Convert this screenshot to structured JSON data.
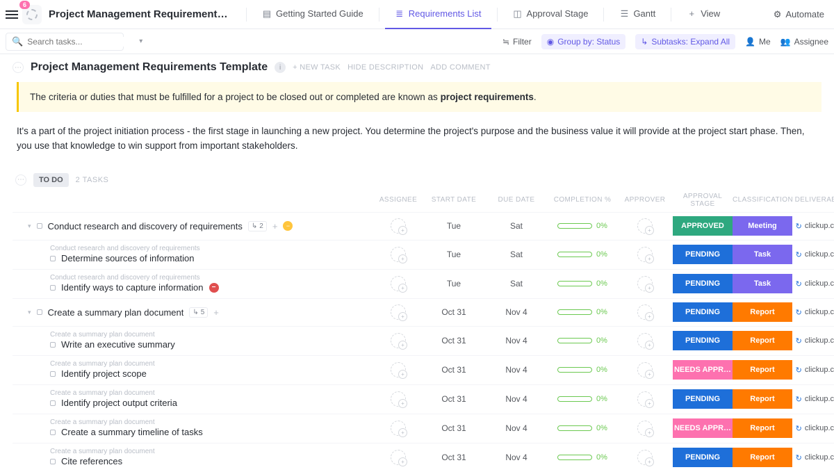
{
  "top": {
    "badge": "6",
    "title": "Project Management Requirements Te…",
    "views": {
      "guide": "Getting Started Guide",
      "reqlist": "Requirements List",
      "approval": "Approval Stage",
      "gantt": "Gantt",
      "view": "View"
    },
    "automate": "Automate"
  },
  "sub": {
    "search_ph": "Search tasks...",
    "filter": "Filter",
    "groupby": "Group by: Status",
    "subtasks": "Subtasks: Expand All",
    "me": "Me",
    "assignee": "Assignee"
  },
  "page": {
    "title": "Project Management Requirements Template",
    "newtask": "NEW TASK",
    "hidedesc": "HIDE DESCRIPTION",
    "addcomment": "ADD COMMENT",
    "banner_pre": "The criteria or duties that must be fulfilled for a project to be closed out or completed are known as ",
    "banner_bold": "project requirements",
    "banner_post": ".",
    "body": "It's a part of the project initiation process - the first stage in launching a new project. You determine the project's purpose and the business value it will provide at the project start phase. Then, you use that knowledge to win support from important stakeholders."
  },
  "group": {
    "status": "TO DO",
    "count": "2 TASKS"
  },
  "columns": {
    "assignee": "ASSIGNEE",
    "startdate": "START DATE",
    "duedate": "DUE DATE",
    "completion": "COMPLETION %",
    "approver": "APPROVER",
    "approvalstage": "APPROVAL STAGE",
    "classification": "CLASSIFICATION",
    "deliverable": "DELIVERABLE"
  },
  "rows": {
    "r1": {
      "name": "Conduct research and discovery of requirements",
      "sub": "2",
      "start": "Tue",
      "due": "Sat",
      "pct": "0%",
      "stage": "APPROVED",
      "cls": "Meeting",
      "del": "clickup.com"
    },
    "r1a": {
      "parent": "Conduct research and discovery of requirements",
      "name": "Determine sources of information",
      "start": "Tue",
      "due": "Sat",
      "pct": "0%",
      "stage": "PENDING",
      "cls": "Task",
      "del": "clickup.com"
    },
    "r1b": {
      "parent": "Conduct research and discovery of requirements",
      "name": "Identify ways to capture information",
      "start": "Tue",
      "due": "Sat",
      "pct": "0%",
      "stage": "PENDING",
      "cls": "Task",
      "del": "clickup.com"
    },
    "r2": {
      "name": "Create a summary plan document",
      "sub": "5",
      "start": "Oct 31",
      "due": "Nov 4",
      "pct": "0%",
      "stage": "PENDING",
      "cls": "Report",
      "del": "clickup.com"
    },
    "r2a": {
      "parent": "Create a summary plan document",
      "name": "Write an executive summary",
      "start": "Oct 31",
      "due": "Nov 4",
      "pct": "0%",
      "stage": "PENDING",
      "cls": "Report",
      "del": "clickup.com"
    },
    "r2b": {
      "parent": "Create a summary plan document",
      "name": "Identify project scope",
      "start": "Oct 31",
      "due": "Nov 4",
      "pct": "0%",
      "stage": "NEEDS APPR…",
      "cls": "Report",
      "del": "clickup.com"
    },
    "r2c": {
      "parent": "Create a summary plan document",
      "name": "Identify project output criteria",
      "start": "Oct 31",
      "due": "Nov 4",
      "pct": "0%",
      "stage": "PENDING",
      "cls": "Report",
      "del": "clickup.com"
    },
    "r2d": {
      "parent": "Create a summary plan document",
      "name": "Create a summary timeline of tasks",
      "start": "Oct 31",
      "due": "Nov 4",
      "pct": "0%",
      "stage": "NEEDS APPR…",
      "cls": "Report",
      "del": "clickup.com"
    },
    "r2e": {
      "parent": "Create a summary plan document",
      "name": "Cite references",
      "start": "Oct 31",
      "due": "Nov 4",
      "pct": "0%",
      "stage": "PENDING",
      "cls": "Report",
      "del": "clickup.com"
    }
  }
}
